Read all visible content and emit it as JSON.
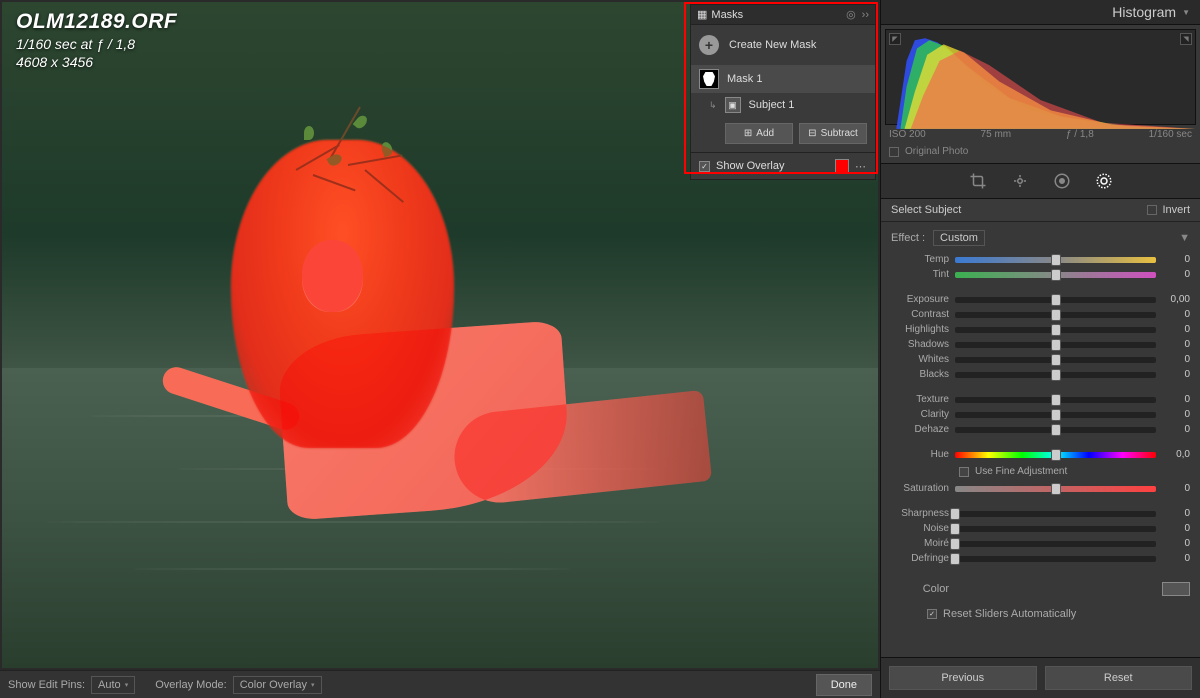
{
  "image_info": {
    "filename": "OLM12189.ORF",
    "exposure": "1/160 sec at ƒ / 1,8",
    "dimensions": "4608 x 3456"
  },
  "masks_panel": {
    "title": "Masks",
    "create": "Create New Mask",
    "mask1": "Mask 1",
    "subject1": "Subject 1",
    "add": "Add",
    "subtract": "Subtract",
    "show_overlay": "Show Overlay"
  },
  "bottom": {
    "pins_label": "Show Edit Pins:",
    "pins_value": "Auto",
    "overlay_label": "Overlay Mode:",
    "overlay_value": "Color Overlay",
    "done": "Done"
  },
  "right_panel": {
    "title": "Histogram",
    "meta": {
      "iso": "ISO 200",
      "focal": "75 mm",
      "aperture": "ƒ / 1,8",
      "shutter": "1/160 sec"
    },
    "original": "Original Photo",
    "select_subject": "Select Subject",
    "invert": "Invert",
    "effect_label": "Effect :",
    "effect_value": "Custom",
    "fine_adj": "Use Fine Adjustment",
    "reset_auto": "Reset Sliders Automatically",
    "color_label": "Color",
    "previous": "Previous",
    "reset": "Reset",
    "sliders": {
      "temp": {
        "label": "Temp",
        "value": "0"
      },
      "tint": {
        "label": "Tint",
        "value": "0"
      },
      "exposure": {
        "label": "Exposure",
        "value": "0,00"
      },
      "contrast": {
        "label": "Contrast",
        "value": "0"
      },
      "highlights": {
        "label": "Highlights",
        "value": "0"
      },
      "shadows": {
        "label": "Shadows",
        "value": "0"
      },
      "whites": {
        "label": "Whites",
        "value": "0"
      },
      "blacks": {
        "label": "Blacks",
        "value": "0"
      },
      "texture": {
        "label": "Texture",
        "value": "0"
      },
      "clarity": {
        "label": "Clarity",
        "value": "0"
      },
      "dehaze": {
        "label": "Dehaze",
        "value": "0"
      },
      "hue": {
        "label": "Hue",
        "value": "0,0"
      },
      "saturation": {
        "label": "Saturation",
        "value": "0"
      },
      "sharpness": {
        "label": "Sharpness",
        "value": "0"
      },
      "noise": {
        "label": "Noise",
        "value": "0"
      },
      "moire": {
        "label": "Moiré",
        "value": "0"
      },
      "defringe": {
        "label": "Defringe",
        "value": "0"
      }
    }
  }
}
